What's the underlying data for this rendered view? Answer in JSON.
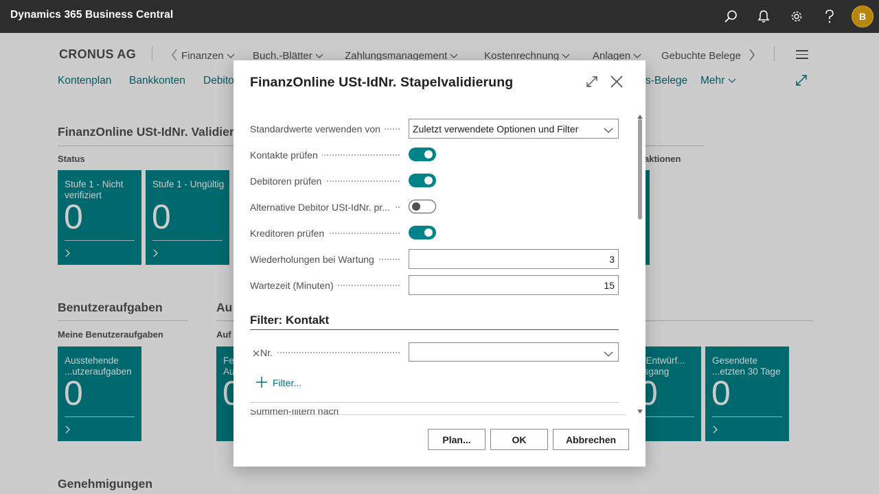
{
  "app": {
    "title": "Dynamics 365 Business Central",
    "avatar_initial": "B",
    "icons": [
      "search-icon",
      "bell-icon",
      "gear-icon",
      "help-icon"
    ]
  },
  "company": "CRONUS AG",
  "nav": {
    "menus": [
      "Finanzen",
      "Buch.-Blätter",
      "Zahlungsmanagement",
      "Kostenrechnung",
      "Anlagen",
      "Gebuchte Belege"
    ]
  },
  "actions": {
    "kontenplan": "Kontenplan",
    "bankkonten": "Bankkonten",
    "debitoren_partial": "Debito",
    "belege_partial": "s-Belege",
    "mehr": "Mehr"
  },
  "background": {
    "validation_section": "FinanzOnline USt-IdNr. Validieru",
    "status_group": "Status",
    "aktionen_group": "aktionen",
    "tiles_status": [
      {
        "label": "Stufe 1 - Nicht verifiziert",
        "value": "0"
      },
      {
        "label": "Stufe 1 - Ungültig",
        "value": "0"
      }
    ],
    "user_tasks_section": "Benutzeraufgaben",
    "user_tasks_group": "Meine Benutzeraufgaben",
    "tile_user_tasks": {
      "label": "Ausstehende ...utzeraufgaben",
      "value": "0"
    },
    "au_section_partial": "Au",
    "au_group_partial": "Auf",
    "tile_partial_fe": {
      "label": "Fe Au",
      "value": "0"
    },
    "tile_email_drafts": {
      "label": "il-Entwürf... usgang",
      "value": "0"
    },
    "tile_sent_emails": {
      "label": "Gesendete ...etzten 30 Tage",
      "value": "0"
    },
    "approvals_section": "Genehmigungen"
  },
  "dialog": {
    "title": "FinanzOnline USt-IdNr. Stapelvalidierung",
    "fields": {
      "defaults_label": "Standardwerte verwenden von",
      "defaults_value": "Zuletzt verwendete Optionen und Filter",
      "contacts_label": "Kontakte prüfen",
      "contacts_on": true,
      "customers_label": "Debitoren prüfen",
      "customers_on": true,
      "alt_customer_label": "Alternative Debitor USt-IdNr. pr...",
      "alt_customer_on": false,
      "vendors_label": "Kreditoren prüfen",
      "vendors_on": true,
      "retries_label": "Wiederholungen bei Wartung",
      "retries_value": "3",
      "wait_label": "Wartezeit (Minuten)",
      "wait_value": "15"
    },
    "filter": {
      "title": "Filter: Kontakt",
      "nr_label": "Nr.",
      "nr_value": "",
      "add_filter": "Filter...",
      "cut_text": "Summen-filtern nach"
    },
    "buttons": {
      "plan": "Plan...",
      "ok": "OK",
      "cancel": "Abbrechen"
    }
  },
  "colors": {
    "topbar": "#2d2d2d",
    "accent": "#008489",
    "link": "#00707a",
    "avatar": "#b8860b"
  }
}
